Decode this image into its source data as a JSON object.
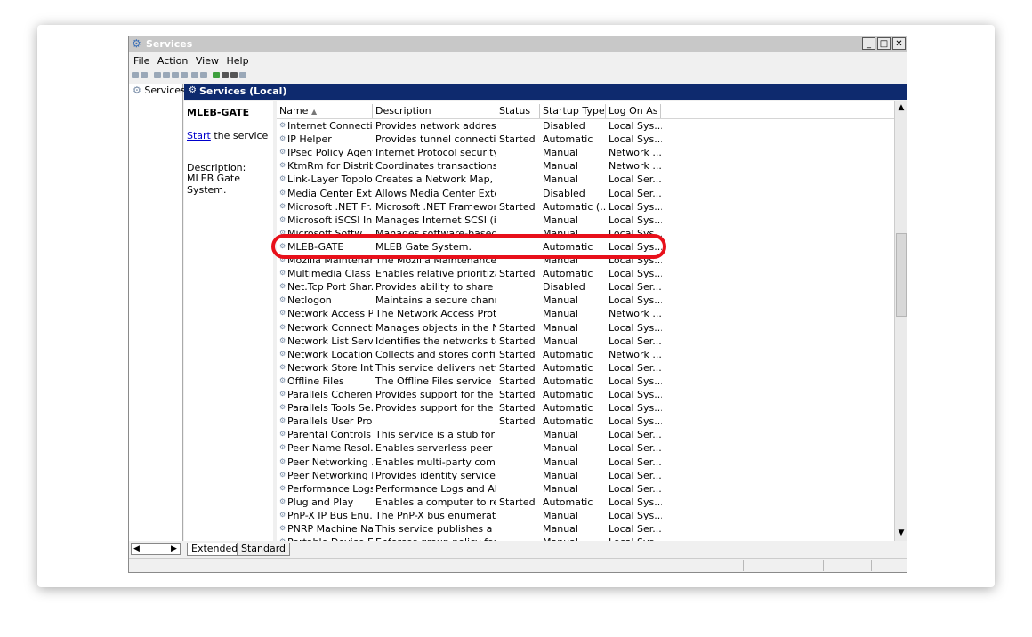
{
  "window": {
    "title": "Services"
  },
  "menu": [
    "File",
    "Action",
    "View",
    "Help"
  ],
  "tree": {
    "root": "Services ("
  },
  "header": {
    "title": "Services (Local)"
  },
  "detail": {
    "service_name": "MLEB-GATE",
    "start_link": "Start",
    "start_suffix": " the service",
    "desc_label": "Description:",
    "desc_text": "MLEB Gate System."
  },
  "columns": {
    "name": "Name",
    "description": "Description",
    "status": "Status",
    "startup": "Startup Type",
    "logon": "Log On As"
  },
  "rows": [
    {
      "name": "Internet Connecti...",
      "desc": "Provides network address...",
      "status": "",
      "startup": "Disabled",
      "logon": "Local Sys..."
    },
    {
      "name": "IP Helper",
      "desc": "Provides tunnel connectivi...",
      "status": "Started",
      "startup": "Automatic",
      "logon": "Local Sys..."
    },
    {
      "name": "IPsec Policy Agent",
      "desc": "Internet Protocol security ...",
      "status": "",
      "startup": "Manual",
      "logon": "Network ..."
    },
    {
      "name": "KtmRm for Distrib...",
      "desc": "Coordinates transactions ...",
      "status": "",
      "startup": "Manual",
      "logon": "Network ..."
    },
    {
      "name": "Link-Layer Topolo...",
      "desc": "Creates a Network Map, c...",
      "status": "",
      "startup": "Manual",
      "logon": "Local Ser..."
    },
    {
      "name": "Media Center Ext...",
      "desc": "Allows Media Center Exte...",
      "status": "",
      "startup": "Disabled",
      "logon": "Local Ser..."
    },
    {
      "name": "Microsoft .NET Fr...",
      "desc": "Microsoft .NET Framewor...",
      "status": "Started",
      "startup": "Automatic (...",
      "logon": "Local Sys..."
    },
    {
      "name": "Microsoft iSCSI Ini...",
      "desc": "Manages Internet SCSI (iS...",
      "status": "",
      "startup": "Manual",
      "logon": "Local Sys..."
    },
    {
      "name": "Microsoft Softw...",
      "desc": "Manages software-based ...",
      "status": "",
      "startup": "Manual",
      "logon": "Local Sys..."
    },
    {
      "name": "MLEB-GATE",
      "desc": "MLEB Gate System.",
      "status": "",
      "startup": "Automatic",
      "logon": "Local Sys..."
    },
    {
      "name": "Mozilla Maintenan...",
      "desc": "The Mozilla Maintenance ...",
      "status": "",
      "startup": "Manual",
      "logon": "Local Sys..."
    },
    {
      "name": "Multimedia Class ...",
      "desc": "Enables relative prioritizat...",
      "status": "Started",
      "startup": "Automatic",
      "logon": "Local Sys..."
    },
    {
      "name": "Net.Tcp Port Shar...",
      "desc": "Provides ability to share T...",
      "status": "",
      "startup": "Disabled",
      "logon": "Local Ser..."
    },
    {
      "name": "Netlogon",
      "desc": "Maintains a secure chann...",
      "status": "",
      "startup": "Manual",
      "logon": "Local Sys..."
    },
    {
      "name": "Network Access P...",
      "desc": "The Network Access Prote...",
      "status": "",
      "startup": "Manual",
      "logon": "Network ..."
    },
    {
      "name": "Network Connecti...",
      "desc": "Manages objects in the N...",
      "status": "Started",
      "startup": "Manual",
      "logon": "Local Sys..."
    },
    {
      "name": "Network List Service",
      "desc": "Identifies the networks to ...",
      "status": "Started",
      "startup": "Manual",
      "logon": "Local Ser..."
    },
    {
      "name": "Network Location ...",
      "desc": "Collects and stores config...",
      "status": "Started",
      "startup": "Automatic",
      "logon": "Network ..."
    },
    {
      "name": "Network Store Int...",
      "desc": "This service delivers netw...",
      "status": "Started",
      "startup": "Automatic",
      "logon": "Local Ser..."
    },
    {
      "name": "Offline Files",
      "desc": "The Offline Files service p...",
      "status": "Started",
      "startup": "Automatic",
      "logon": "Local Sys..."
    },
    {
      "name": "Parallels Coheren...",
      "desc": "Provides support for the C...",
      "status": "Started",
      "startup": "Automatic",
      "logon": "Local Sys..."
    },
    {
      "name": "Parallels Tools Se...",
      "desc": "Provides support for the i...",
      "status": "Started",
      "startup": "Automatic",
      "logon": "Local Sys..."
    },
    {
      "name": "Parallels User Pro...",
      "desc": "",
      "status": "Started",
      "startup": "Automatic",
      "logon": "Local Sys..."
    },
    {
      "name": "Parental Controls",
      "desc": "This service is a stub for ...",
      "status": "",
      "startup": "Manual",
      "logon": "Local Ser..."
    },
    {
      "name": "Peer Name Resol...",
      "desc": "Enables serverless peer n...",
      "status": "",
      "startup": "Manual",
      "logon": "Local Ser..."
    },
    {
      "name": "Peer Networking ...",
      "desc": "Enables multi-party comm...",
      "status": "",
      "startup": "Manual",
      "logon": "Local Ser..."
    },
    {
      "name": "Peer Networking I...",
      "desc": "Provides identity services ...",
      "status": "",
      "startup": "Manual",
      "logon": "Local Ser..."
    },
    {
      "name": "Performance Logs...",
      "desc": "Performance Logs and Ale...",
      "status": "",
      "startup": "Manual",
      "logon": "Local Ser..."
    },
    {
      "name": "Plug and Play",
      "desc": "Enables a computer to rec...",
      "status": "Started",
      "startup": "Automatic",
      "logon": "Local Sys..."
    },
    {
      "name": "PnP-X IP Bus Enu...",
      "desc": "The PnP-X bus enumerato...",
      "status": "",
      "startup": "Manual",
      "logon": "Local Sys..."
    },
    {
      "name": "PNRP Machine Na...",
      "desc": "This service publishes a m...",
      "status": "",
      "startup": "Manual",
      "logon": "Local Ser..."
    },
    {
      "name": "Portable Device E...",
      "desc": "Enforces group policy for ...",
      "status": "",
      "startup": "Manual",
      "logon": "Local Sys..."
    }
  ],
  "tabs": [
    "Extended",
    "Standard"
  ],
  "colors": {
    "highlight_ring": "#e8101a",
    "header_bg": "#0e2a6e"
  }
}
